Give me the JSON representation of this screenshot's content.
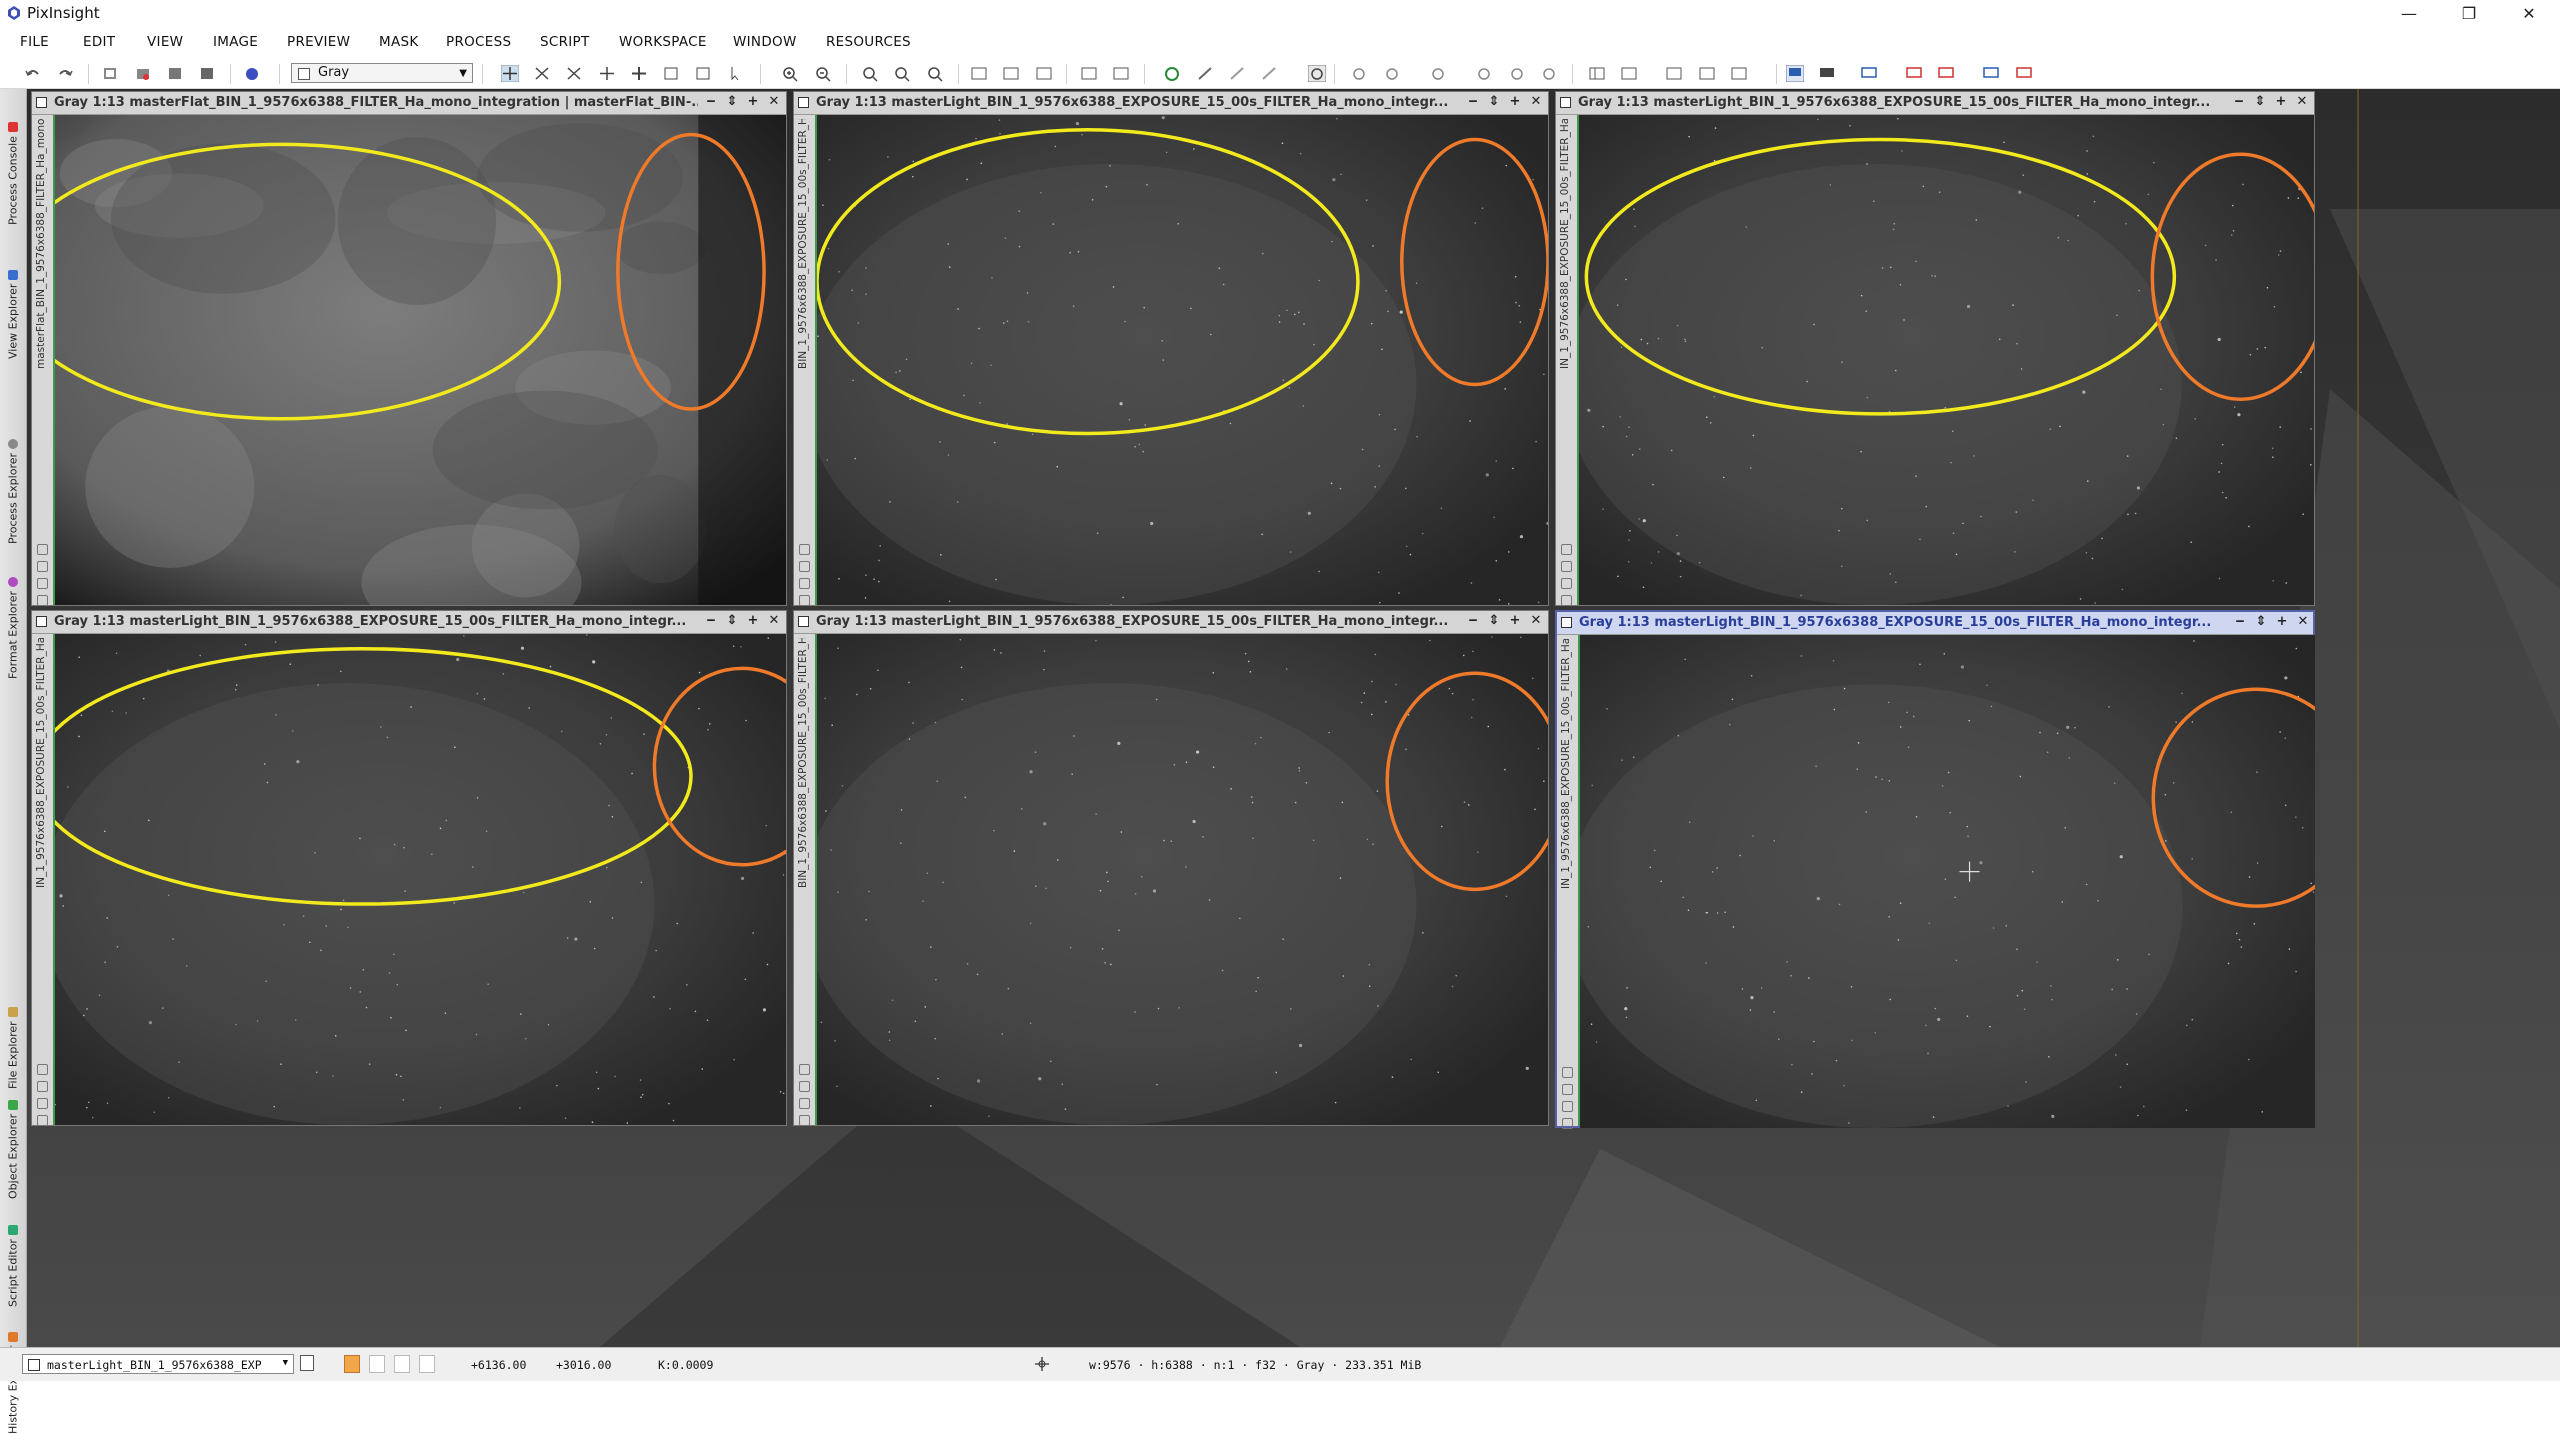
{
  "app": {
    "title": "PixInsight",
    "window_controls": [
      "—",
      "❐",
      "✕"
    ]
  },
  "menu": [
    "FILE",
    "EDIT",
    "VIEW",
    "IMAGE",
    "PREVIEW",
    "MASK",
    "PROCESS",
    "SCRIPT",
    "WORKSPACE",
    "WINDOW",
    "RESOURCES"
  ],
  "toolbar": {
    "color_space": "Gray"
  },
  "side_tabs": [
    "Process Console",
    "View Explorer",
    "Process Explorer",
    "Format Explorer",
    "File Explorer",
    "Object Explorer",
    "Script Editor",
    "History Explorer"
  ],
  "windows": [
    {
      "title": "Gray 1:13 masterFlat_BIN_1_9576x6388_FILTER_Ha_mono_integration | masterFlat_BIN-...",
      "id": "masterFlat_BIN_1_9576x6388_FILTER_Ha_mono_integration",
      "type": "flat",
      "active": false,
      "ellipses": [
        "yellow",
        "orange"
      ]
    },
    {
      "title": "Gray 1:13 masterLight_BIN_1_9576x6388_EXPOSURE_15_00s_FILTER_Ha_mono_integr...",
      "id": "BIN_1_9576x6388_EXPOSURE_15_00s_FILTER_Ha_mono_integration",
      "type": "light",
      "active": false,
      "ellipses": [
        "yellow",
        "orange"
      ]
    },
    {
      "title": "Gray 1:13 masterLight_BIN_1_9576x6388_EXPOSURE_15_00s_FILTER_Ha_mono_integr...",
      "id": "IN_1_9576x6388_EXPOSURE_15_00s_FILTER_Ha_mono_integration1",
      "type": "light",
      "active": false,
      "ellipses": [
        "yellow",
        "orange"
      ]
    },
    {
      "title": "Gray 1:13 masterLight_BIN_1_9576x6388_EXPOSURE_15_00s_FILTER_Ha_mono_integr...",
      "id": "IN_1_9576x6388_EXPOSURE_15_00s_FILTER_Ha_mono_integration2",
      "type": "light",
      "active": false,
      "ellipses": [
        "yellow",
        "orange"
      ]
    },
    {
      "title": "Gray 1:13 masterLight_BIN_1_9576x6388_EXPOSURE_15_00s_FILTER_Ha_mono_integr...",
      "id": "BIN_1_9576x6388_EXPOSURE_15_00s_FILTER_Ha_mono_integration3",
      "type": "light",
      "active": false,
      "ellipses": [
        "orange"
      ]
    },
    {
      "title": "Gray 1:13 masterLight_BIN_1_9576x6388_EXPOSURE_15_00s_FILTER_Ha_mono_integr...",
      "id": "IN_1_9576x6388_EXPOSURE_15_00s_FILTER_Ha_mono_integration4",
      "type": "light",
      "active": true,
      "ellipses": [
        "orange"
      ]
    }
  ],
  "window_buttons": [
    "‒",
    "⇕",
    "+",
    "✕"
  ],
  "statusbar": {
    "view": "masterLight_BIN_1_9576x6388_EXP",
    "x": "+6136.00",
    "y": "+3016.00",
    "k": "K:0.0009",
    "info": "w:9576 · h:6388 · n:1 · f32 · Gray · 233.351 MiB"
  },
  "colors": {
    "highlight_yellow": "#f2ea1c",
    "highlight_orange": "#ee7a2a",
    "active_border": "#5760a8"
  }
}
